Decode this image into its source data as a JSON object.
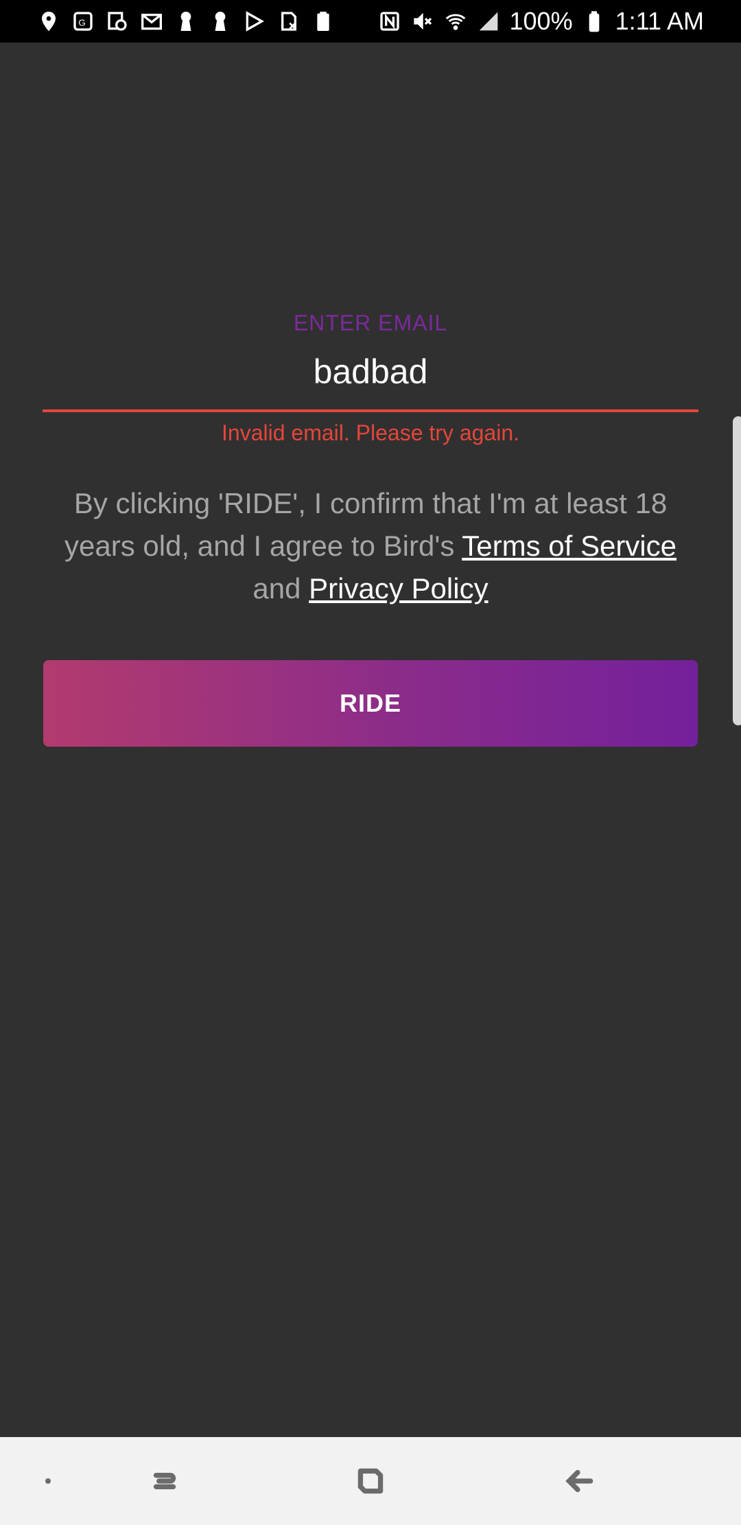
{
  "status_bar": {
    "icons_left": [
      "location-pin-icon",
      "maps-app-icon",
      "calendar-clock-icon",
      "gmail-icon",
      "keyhole-icon",
      "keyhole-icon",
      "play-store-icon",
      "sim-off-icon",
      "battery-saver-icon"
    ],
    "icons_right": [
      "nfc-icon",
      "mute-icon",
      "wifi-icon",
      "signal-icon",
      "battery-icon"
    ],
    "battery": "100%",
    "time": "1:11 AM"
  },
  "form": {
    "email_label": "ENTER EMAIL",
    "email_value": "badbad",
    "error_text": "Invalid email. Please try again.",
    "legal_prefix": "By clicking 'RIDE', I confirm that I'm at least 18 years old, and I agree to Bird's ",
    "terms_link": "Terms of Service",
    "legal_and": " and ",
    "privacy_link": "Privacy Policy",
    "ride_label": "RIDE",
    "error_color": "#e4463a",
    "label_color": "#7b2a9b"
  },
  "nav_bar": {
    "buttons": [
      "dot-icon",
      "recents-icon",
      "home-icon",
      "back-icon"
    ]
  }
}
